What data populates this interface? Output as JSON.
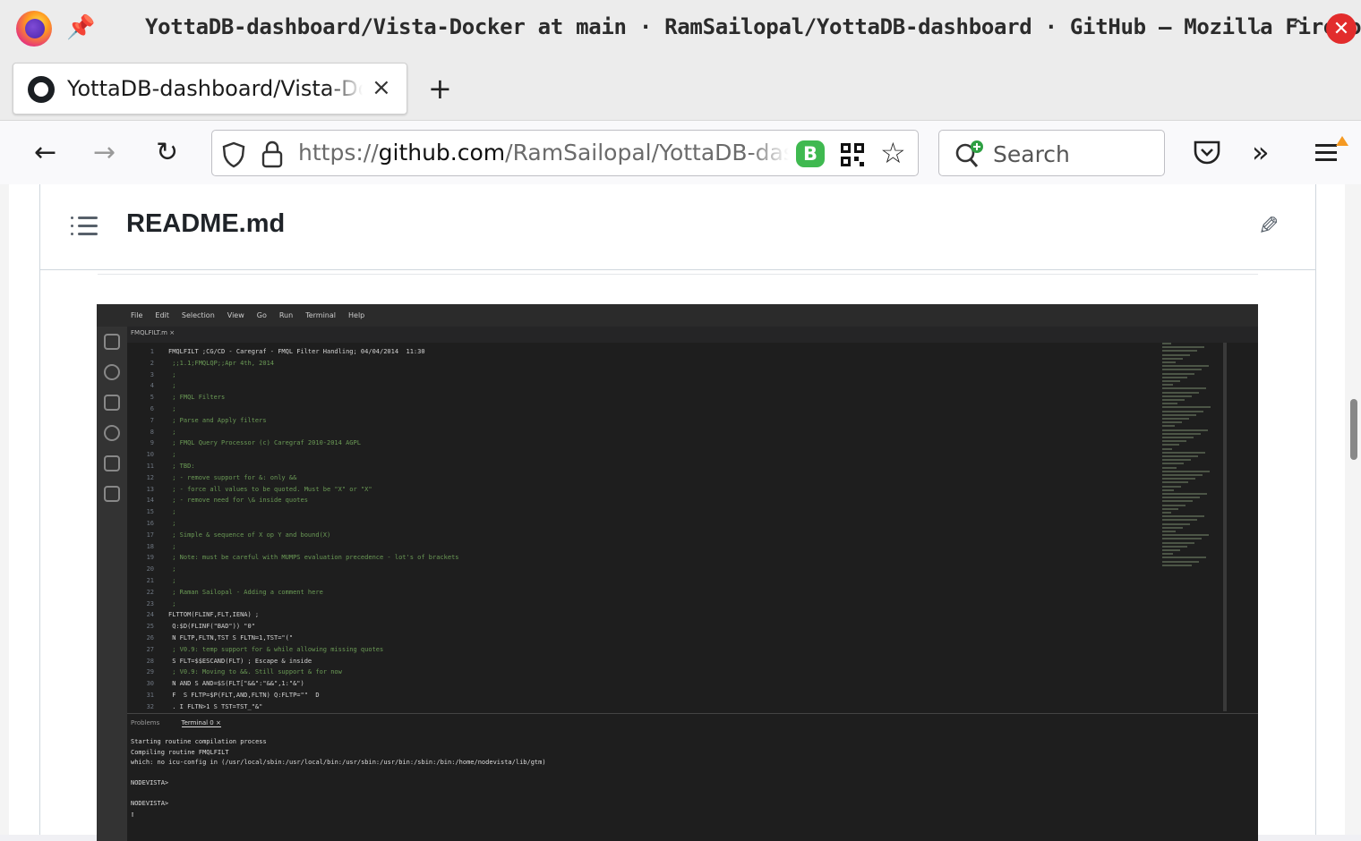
{
  "window": {
    "title": "YottaDB-dashboard/Vista-Docker at main · RamSailopal/YottaDB-dashboard · GitHub — Mozilla Firefox"
  },
  "tab": {
    "label": "YottaDB-dashboard/Vista-Doc",
    "close_glyph": "×",
    "new_tab_glyph": "+"
  },
  "nav": {
    "back": "←",
    "forward": "→",
    "reload": "↻"
  },
  "url": {
    "scheme": "https://",
    "host": "github.com",
    "path": "/RamSailopal/YottaDB-dash"
  },
  "search": {
    "placeholder": "Search"
  },
  "readme": {
    "title": "README.md"
  },
  "ide": {
    "menu": [
      "File",
      "Edit",
      "Selection",
      "View",
      "Go",
      "Run",
      "Terminal",
      "Help"
    ],
    "tab": "FMQLFILT.m ×",
    "line_numbers": [
      "1",
      "2",
      "3",
      "4",
      "5",
      "6",
      "7",
      "8",
      "9",
      "10",
      "11",
      "12",
      "13",
      "14",
      "15",
      "16",
      "17",
      "18",
      "19",
      "20",
      "21",
      "22",
      "23",
      "24",
      "25",
      "26",
      "27",
      "28",
      "29",
      "30",
      "31",
      "32"
    ],
    "code": [
      "FMQLFILT ;CG/CD - Caregraf - FMQL Filter Handling; 04/04/2014  11:30",
      " ;;1.1;FMQLQP;;Apr 4th, 2014",
      " ;",
      " ;",
      " ; FMQL Filters",
      " ;",
      " ; Parse and Apply filters",
      " ;",
      " ; FMQL Query Processor (c) Caregraf 2010-2014 AGPL",
      " ;",
      " ; TBD:",
      " ; - remove support for &: only &&",
      " ; - force all values to be quoted. Must be \"X\" or \"X\"",
      " ; - remove need for \\& inside quotes",
      " ;",
      " ;",
      " ; Simple & sequence of X op Y and bound(X)",
      " ;",
      " ; Note: must be careful with MUMPS evaluation precedence - lot's of brackets",
      " ;",
      " ;",
      " ; Raman Sailopal - Adding a comment here",
      " ;",
      "FLTTOM(FLINF,FLT,IENA) ;",
      " Q:$D(FLINF(\"BAD\")) \"0\"",
      " N FLTP,FLTN,TST S FLTN=1,TST=\"(\"",
      " ; V0.9: temp support for & while allowing missing quotes",
      " S FLT=$$ESCAND(FLT) ; Escape & inside",
      " ; V0.9: Moving to &&. Still support & for now",
      " N AND S AND=$S(FLT[\"&&\":\"&&\",1:\"&\")",
      " F  S FLTP=$P(FLT,AND,FLTN) Q:FLTP=\"\"  D",
      " . I FLTN>1 S TST=TST_\"&\""
    ],
    "panel_tabs": [
      "Problems",
      "Terminal 0 ×"
    ],
    "terminal": [
      "Starting routine compilation process",
      "Compiling routine FMQLFILT",
      "which: no icu-config in (/usr/local/sbin:/usr/local/bin:/usr/sbin:/usr/bin:/sbin:/bin:/home/nodevista/lib/gtm)",
      "",
      "NODEVISTA>",
      "",
      "NODEVISTA>",
      "▯"
    ]
  }
}
